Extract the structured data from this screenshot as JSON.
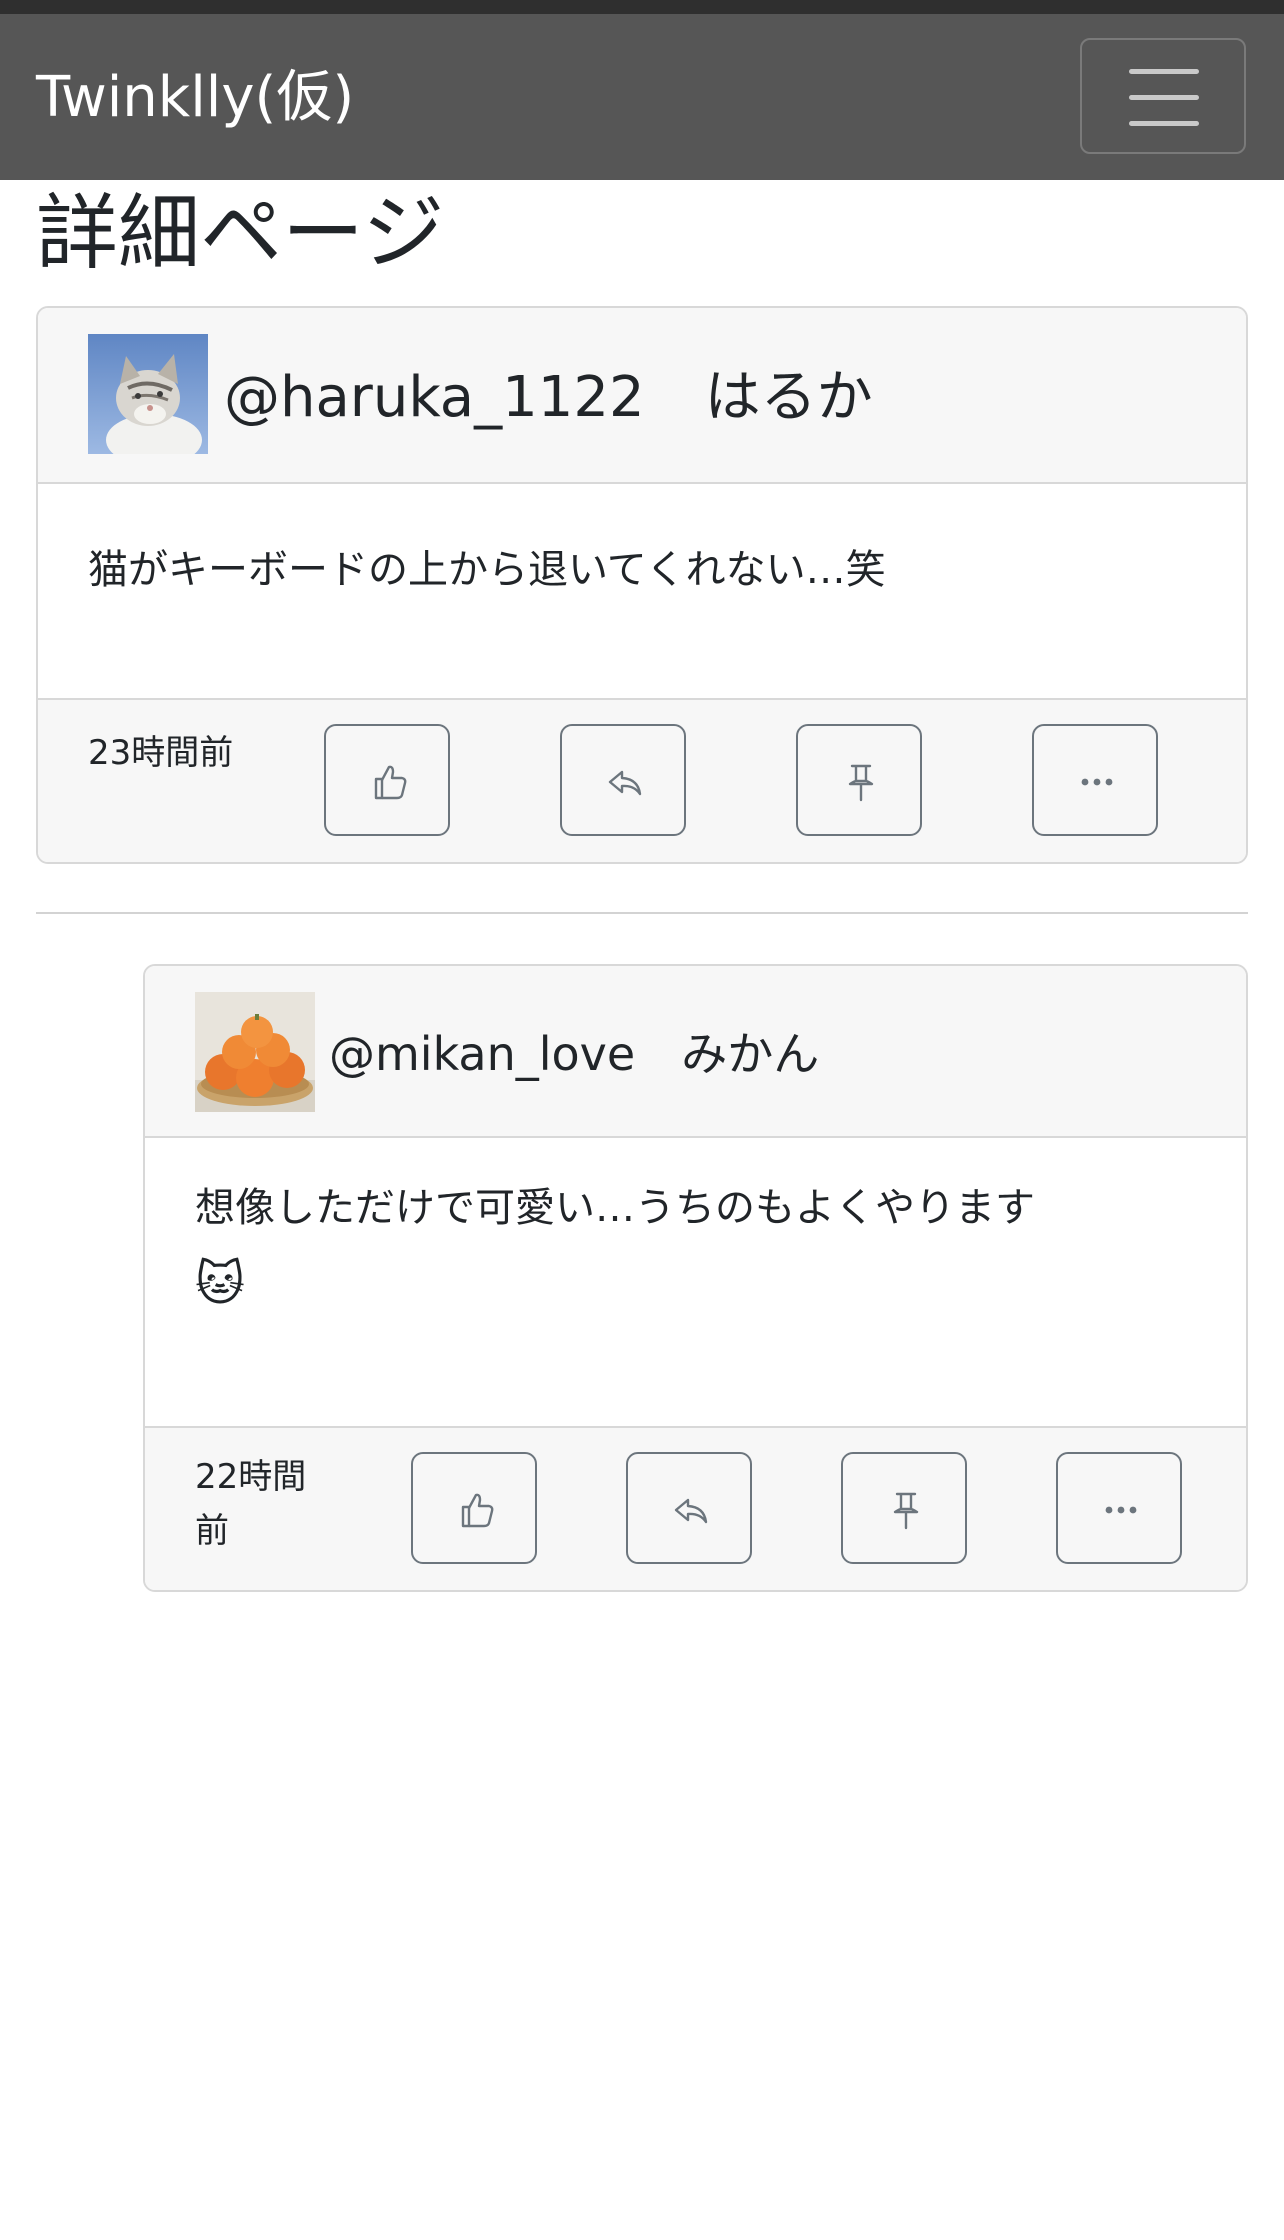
{
  "navbar": {
    "brand": "Twinklly(仮)",
    "menu_icon": "hamburger-menu-icon"
  },
  "page": {
    "title": "詳細ページ"
  },
  "post": {
    "avatar": "cat-photo-avatar",
    "username": "@haruka_1122",
    "display_name": "はるか",
    "body": "猫がキーボードの上から退いてくれない…笑",
    "timestamp": "23時間前",
    "actions": [
      "like-icon",
      "reply-icon",
      "pin-icon",
      "more-icon"
    ]
  },
  "reply": {
    "avatar": "mikan-photo-avatar",
    "username": "@mikan_love",
    "display_name": "みかん",
    "body_line1": "想像しただけで可愛い…うちのもよくやります",
    "body_emoji": "🐱",
    "timestamp_line1": "22時間",
    "timestamp_line2": "前",
    "actions": [
      "like-icon",
      "reply-icon",
      "pin-icon",
      "more-icon"
    ]
  },
  "colors": {
    "navbar": "#565656",
    "card_border": "#d8d8d8",
    "card_muted_bg": "#f7f7f7",
    "button_border": "#6c757d",
    "text": "#212529"
  }
}
